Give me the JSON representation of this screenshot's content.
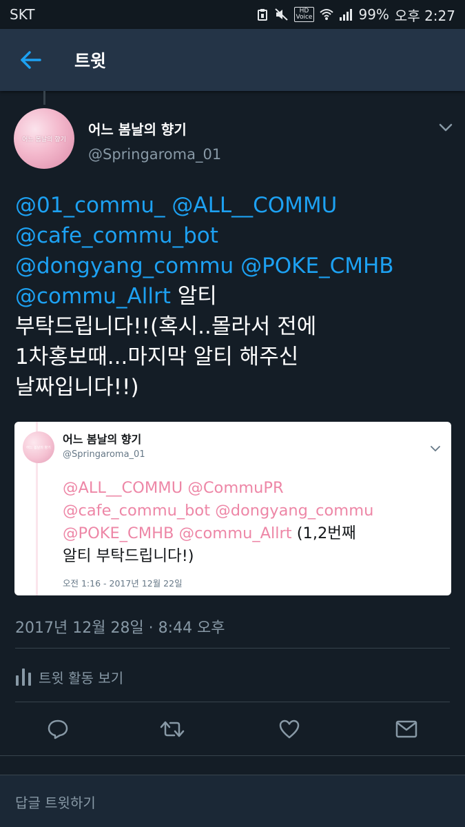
{
  "status_bar": {
    "carrier": "SKT",
    "hd_label": "HD",
    "voice_label": "Voice",
    "battery": "99%",
    "time": "오후 2:27"
  },
  "header": {
    "title": "트윗"
  },
  "tweet": {
    "author_name": "어느 봄날의 향기",
    "author_handle": "@Springaroma_01",
    "avatar_text": "어느 봄날의 향기",
    "text": {
      "mention_1": "@01_commu_",
      "mention_2": "@ALL__COMMU",
      "mention_3": "@cafe_commu_bot",
      "mention_4": "@dongyang_commu",
      "mention_5": "@POKE_CMHB",
      "mention_6": "@commu_Allrt",
      "body_1": "알티",
      "body_2": "부탁드립니다!!(혹시..몰라서 전에",
      "body_3": "1차홍보때...마지막 알티 해주신",
      "body_4": "날짜입니다!!)"
    },
    "timestamp": "2017년 12월 28일 · 8:44 오후",
    "activity_label": "트윗 활동 보기"
  },
  "quoted": {
    "author_name": "어느 봄날의 향기",
    "author_handle": "@Springaroma_01",
    "avatar_text": "어느 봄날의 향기",
    "mention_1": "@ALL__COMMU",
    "mention_2": "@CommuPR",
    "mention_3": "@cafe_commu_bot",
    "mention_4": "@dongyang_commu",
    "mention_5": "@POKE_CMHB",
    "mention_6": "@commu_Allrt",
    "body_1": "(1,2번째",
    "body_2": "알티 부탁드립니다!)",
    "time": "오전 1:16 - 2017년 12월 22일"
  },
  "actions": {
    "reply_icon": "reply-icon",
    "retweet_icon": "retweet-icon",
    "like_icon": "heart-icon",
    "message_icon": "envelope-icon"
  },
  "reply_bar": {
    "placeholder": "답글 트윗하기"
  },
  "colors": {
    "background": "#141d26",
    "header": "#243447",
    "accent": "#1da1f2",
    "muted": "#8899a6",
    "quote_mention": "#e0245e"
  }
}
